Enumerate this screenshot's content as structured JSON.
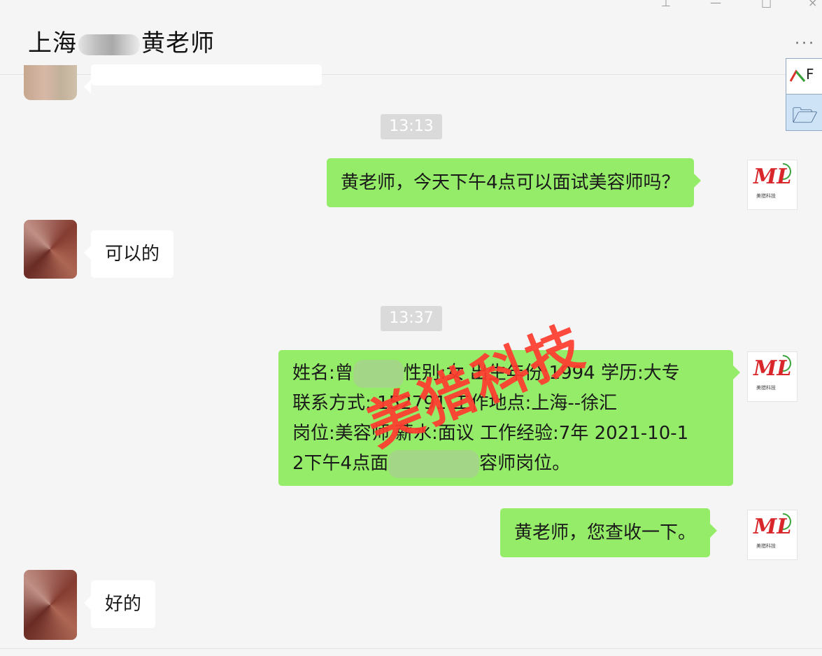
{
  "header": {
    "title_prefix": "上海",
    "title_suffix": "黄老师",
    "more": "···"
  },
  "window_controls": [
    "pin-icon",
    "minimize-icon",
    "maximize-icon",
    "close-icon"
  ],
  "side_tools": [
    {
      "name": "f-tool-icon",
      "glyph": "F"
    },
    {
      "name": "folder-open-icon",
      "glyph": "🗁"
    }
  ],
  "contact_logo": {
    "text": "ML",
    "sub": "美猎科技"
  },
  "messages": {
    "time1": "13:13",
    "m1": "黄老师，今天下午4点可以面试美容师吗？",
    "m2": "可以的",
    "time2": "13:37",
    "m3_line1": "姓名:曾",
    "m3_line1b": "性别:女 出生年份:1994 学历:大专",
    "m3_line2": "联系方式: 15279",
    "m3_line2b": "1 工作地点:上海--徐汇",
    "m3_line3": "岗位:美容师 薪水:面议 工作经验:7年 2021-10-1",
    "m3_line4a": "2下午4点面",
    "m3_line4b": "容师岗位。",
    "m4": "黄老师，您查收一下。",
    "m5": "好的"
  },
  "watermark": "美猎科技",
  "colors": {
    "sent_bubble": "#95ec69",
    "received_bubble": "#ffffff",
    "watermark": "#ff3b2e"
  }
}
